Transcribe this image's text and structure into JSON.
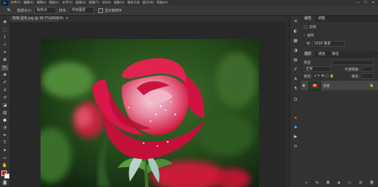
{
  "app": {
    "logo": "Ps"
  },
  "menu": [
    "文件(F)",
    "编辑(E)",
    "图像(I)",
    "图层(L)",
    "文字(Y)",
    "选择(S)",
    "滤镜(T)",
    "3D(D)",
    "视图(V)",
    "增效工具",
    "窗口(W)",
    "帮助(H)"
  ],
  "window_controls": {
    "minimize": "—",
    "maximize": "☐",
    "close": "✕"
  },
  "options": {
    "tool_icon": "eyedropper-icon",
    "sample_size_label": "取样大小:",
    "sample_size_value": "取样点",
    "sample_label": "样本:",
    "sample_value": "所有图层",
    "show_ring_label": "显示取样环"
  },
  "document_tab": {
    "title": "玫瑰 副本.jpg @ 36.7%(RGB/8)",
    "close": "×"
  },
  "colors": {
    "foreground": "#d20a1e",
    "background": "#ffffff",
    "accent": "#31a8ff"
  },
  "panel_top": {
    "tabs": [
      "属性",
      "调整"
    ],
    "doc_label": "文档",
    "canvas_label": "画布",
    "width_label": "W",
    "width_value": "1000 像素"
  },
  "panel_layers": {
    "tabs": [
      "图层",
      "通道",
      "路径"
    ],
    "kind_label": "类型",
    "mode_value": "正常",
    "opacity_label": "不透明度:",
    "lock_label": "锁定:",
    "fill_label": "填充:",
    "layer_name": "背景"
  }
}
